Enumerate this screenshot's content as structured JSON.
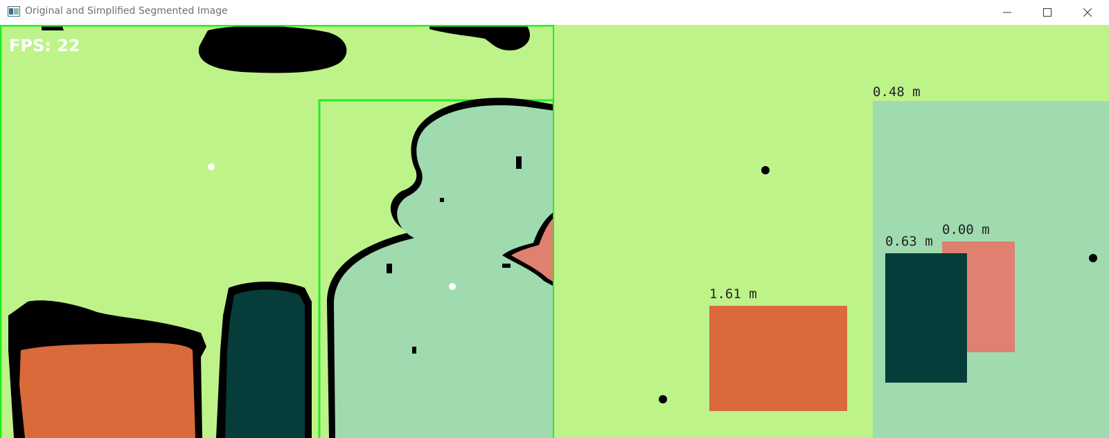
{
  "window": {
    "title": "Original and Simplified Segmented Image",
    "controls": [
      "minimize",
      "maximize",
      "close"
    ],
    "icon": "app-window-icon"
  },
  "original_view": {
    "fps_text": "FPS: 22",
    "colors": {
      "background": "#bef38a",
      "outline": "#000000",
      "bbox": "#00ff00",
      "orange": "#da6a3a",
      "teal_dark": "#063c3a",
      "mint": "#a0dbb0",
      "salmon": "#e08070",
      "centroid": "#ffffff"
    }
  },
  "simplified_view": {
    "labels": [
      "0.48 m",
      "0.00 m",
      "0.63 m",
      "1.61 m"
    ],
    "colors": {
      "background": "#bef38a",
      "mint": "#a0dbb0",
      "salmon": "#e08070",
      "teal_dark": "#063c3a",
      "orange": "#da6a3a",
      "centroid": "#000000"
    }
  }
}
